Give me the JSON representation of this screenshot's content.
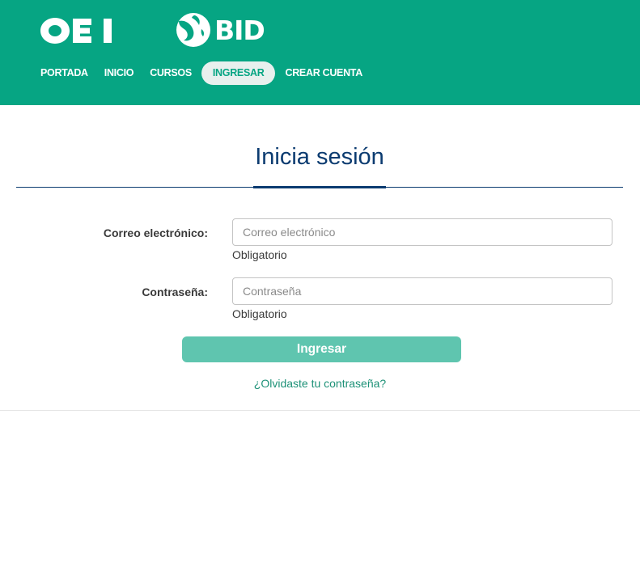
{
  "brand": {
    "oei_logo_text": "OEI",
    "bid_logo_text": "BID",
    "header_color": "#06a583"
  },
  "nav": {
    "items": [
      {
        "label": "PORTADA"
      },
      {
        "label": "INICIO"
      },
      {
        "label": "CURSOS"
      },
      {
        "label": "INGRESAR",
        "active": true
      },
      {
        "label": "CREAR CUENTA"
      }
    ]
  },
  "login": {
    "title": "Inicia sesión",
    "email": {
      "label": "Correo electrónico:",
      "placeholder": "Correo electrónico",
      "value": "",
      "hint": "Obligatorio"
    },
    "password": {
      "label": "Contraseña:",
      "placeholder": "Contraseña",
      "value": "",
      "hint": "Obligatorio"
    },
    "submit_label": "Ingresar",
    "forgot_label": "¿Olvidaste tu contraseña?"
  },
  "colors": {
    "accent": "#06a583",
    "button": "#5fc5af",
    "title": "#0b3b70",
    "link": "#1d9177"
  }
}
